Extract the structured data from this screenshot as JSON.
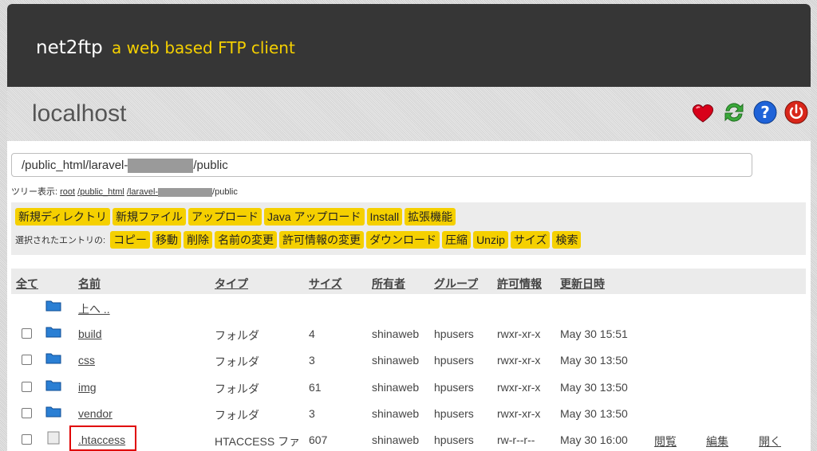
{
  "brand": {
    "name": "net2ftp",
    "tagline": "a web based FTP client"
  },
  "host": {
    "name": "localhost",
    "icons": [
      "bookmark-heart-icon",
      "refresh-icon",
      "help-icon",
      "logout-power-icon"
    ]
  },
  "path": {
    "prefix": "/public_html/laravel-",
    "suffix": "/public"
  },
  "tree": {
    "label": "ツリー表示: ",
    "root": "root",
    "public_html": "/public_html",
    "laravel": "/laravel-",
    "public": "/public"
  },
  "actions": {
    "row1": [
      "新規ディレクトリ",
      "新規ファイル",
      "アップロード",
      "Java アップロード",
      "Install",
      "拡張機能"
    ],
    "selected_label": "選択されたエントリの:",
    "row2": [
      "コピー",
      "移動",
      "削除",
      "名前の変更",
      "許可情報の変更",
      "ダウンロード",
      "圧縮",
      "Unzip",
      "サイズ",
      "検索"
    ]
  },
  "table": {
    "headers": {
      "all": "全て",
      "name": "名前",
      "type": "タイプ",
      "size": "サイズ",
      "owner": "所有者",
      "group": "グループ",
      "perms": "許可情報",
      "modified": "更新日時"
    },
    "up_label": "上へ ..",
    "rows": [
      {
        "name": "build",
        "type": "フォルダ",
        "size": "4",
        "owner": "shinaweb",
        "group": "hpusers",
        "perms": "rwxr-xr-x",
        "modified": "May 30 15:51"
      },
      {
        "name": "css",
        "type": "フォルダ",
        "size": "3",
        "owner": "shinaweb",
        "group": "hpusers",
        "perms": "rwxr-xr-x",
        "modified": "May 30 13:50"
      },
      {
        "name": "img",
        "type": "フォルダ",
        "size": "61",
        "owner": "shinaweb",
        "group": "hpusers",
        "perms": "rwxr-xr-x",
        "modified": "May 30 13:50"
      },
      {
        "name": "vendor",
        "type": "フォルダ",
        "size": "3",
        "owner": "shinaweb",
        "group": "hpusers",
        "perms": "rwxr-xr-x",
        "modified": "May 30 13:50"
      },
      {
        "name": ".htaccess",
        "type": "HTACCESS ファ",
        "size": "607",
        "owner": "shinaweb",
        "group": "hpusers",
        "perms": "rw-r--r--",
        "modified": "May 30 16:00",
        "view": "閲覧",
        "edit": "編集",
        "open": "開く"
      }
    ]
  },
  "colors": {
    "topbar": "#363636",
    "accent": "#f5d000",
    "highlight": "#e00000"
  }
}
